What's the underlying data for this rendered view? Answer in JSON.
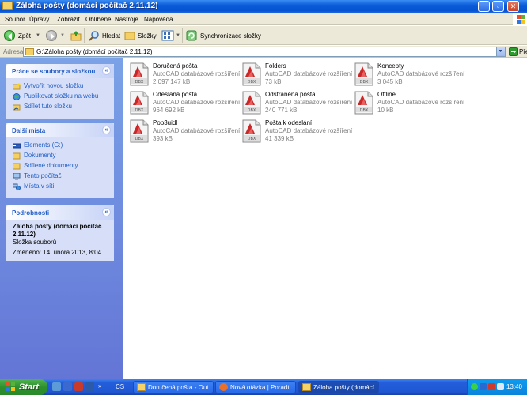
{
  "window": {
    "title": "Záloha pošty (domácí počítač 2.11.12)"
  },
  "menu": [
    "Soubor",
    "Úpravy",
    "Zobrazit",
    "Oblíbené",
    "Nástroje",
    "Nápověda"
  ],
  "toolbar": {
    "back": "Zpět",
    "search": "Hledat",
    "folders": "Složky",
    "sync": "Synchronizace složky"
  },
  "address": {
    "label": "Adresa",
    "path": "G:\\Záloha pošty (domácí počítač 2.11.12)",
    "go": "Přejít"
  },
  "tasks_panel": {
    "title": "Práce se soubory a složkou",
    "items": [
      "Vytvořit novou složku",
      "Publikovat složku na webu",
      "Sdílet tuto složku"
    ]
  },
  "places_panel": {
    "title": "Další místa",
    "items": [
      "Elements (G:)",
      "Dokumenty",
      "Sdílené dokumenty",
      "Tento počítač",
      "Místa v síti"
    ]
  },
  "details_panel": {
    "title": "Podrobnosti",
    "name_line1": "Záloha pošty (domácí počítač",
    "name_line2": "2.11.12)",
    "kind": "Složka souborů",
    "modified": "Změněno: 14. února 2013, 8:04"
  },
  "files": [
    {
      "name": "Doručená pošta",
      "type": "AutoCAD databázové rozšíření",
      "size": "2 097 147 kB"
    },
    {
      "name": "Folders",
      "type": "AutoCAD databázové rozšíření",
      "size": "73 kB"
    },
    {
      "name": "Koncepty",
      "type": "AutoCAD databázové rozšíření",
      "size": "3 045 kB"
    },
    {
      "name": "Odeslaná pošta",
      "type": "AutoCAD databázové rozšíření",
      "size": "964 692 kB"
    },
    {
      "name": "Odstraněná pošta",
      "type": "AutoCAD databázové rozšíření",
      "size": "240 771 kB"
    },
    {
      "name": "Offline",
      "type": "AutoCAD databázové rozšíření",
      "size": "10 kB"
    },
    {
      "name": "Pop3uidl",
      "type": "AutoCAD databázové rozšíření",
      "size": "393 kB"
    },
    {
      "name": "Pošta k odeslání",
      "type": "AutoCAD databázové rozšíření",
      "size": "41 339 kB"
    }
  ],
  "file_icon_label": "DBX",
  "taskbar": {
    "start": "Start",
    "quicklaunch_label": "CS",
    "tasks": [
      "Doručená pošta - Out...",
      "Nová otázka | Poradt...",
      "Záloha pošty (domácí..."
    ],
    "clock": "13:40"
  }
}
